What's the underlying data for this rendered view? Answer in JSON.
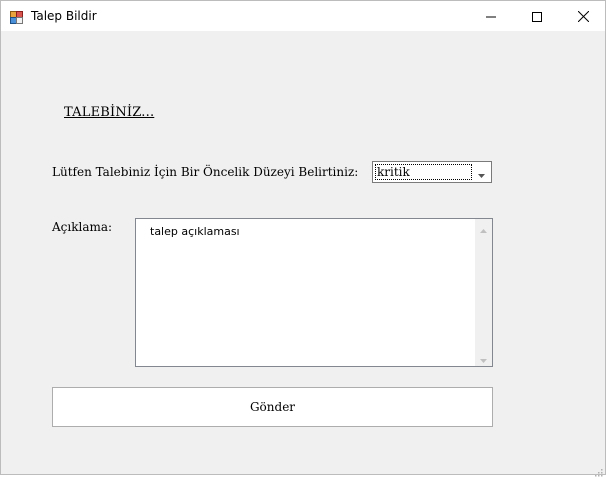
{
  "window": {
    "title": "Talep Bildir"
  },
  "form": {
    "heading": "TALEBİNİZ...",
    "priority_label": "Lütfen Talebiniz İçin Bir Öncelik Düzeyi Belirtiniz:",
    "priority_value": "kritik",
    "description_label": "Açıklama:",
    "description_value": "talep açıklaması",
    "submit_label": "Gönder"
  },
  "icons": {
    "app": "app-icon",
    "minimize": "minimize-icon",
    "maximize": "maximize-icon",
    "close": "close-icon",
    "dropdown": "chevron-down-icon"
  },
  "colors": {
    "window_bg": "#f0f0f0",
    "titlebar_bg": "#ffffff",
    "control_border": "#7a7a7a"
  }
}
